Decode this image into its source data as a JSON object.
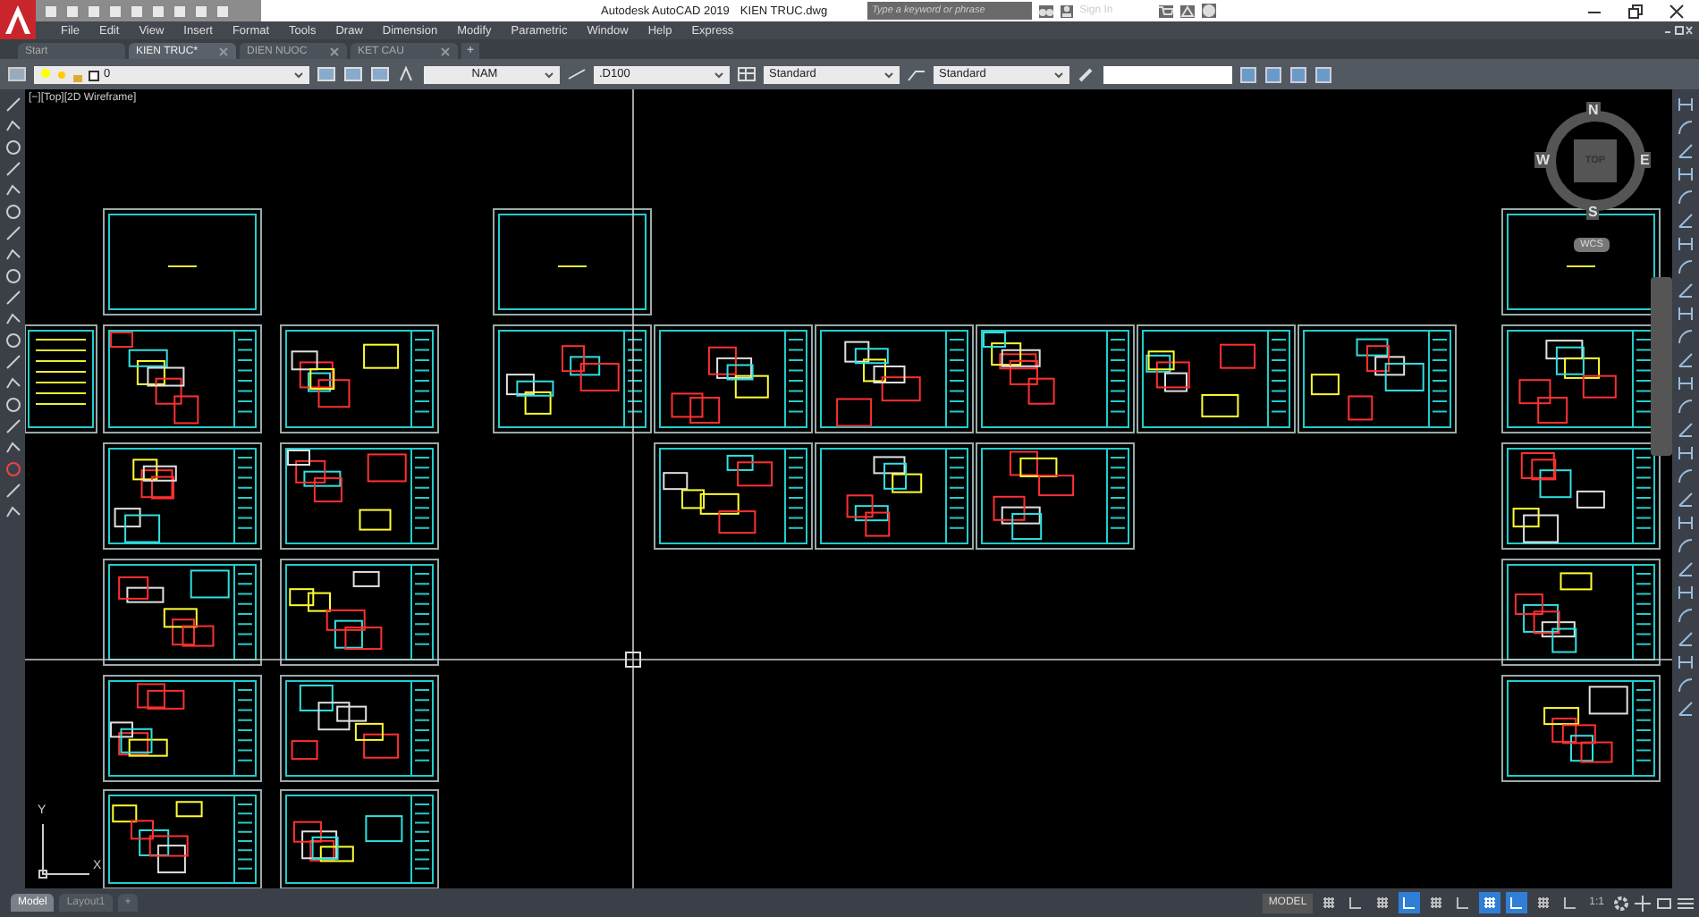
{
  "window": {
    "app_title": "Autodesk AutoCAD 2019",
    "file_name": "KIEN TRUC.dwg"
  },
  "search": {
    "placeholder": "Type a keyword or phrase"
  },
  "sign_in": "Sign In",
  "menu": [
    "File",
    "Edit",
    "View",
    "Insert",
    "Format",
    "Tools",
    "Draw",
    "Dimension",
    "Modify",
    "Parametric",
    "Window",
    "Help",
    "Express"
  ],
  "doc_tabs": [
    {
      "label": "Start",
      "selected": false,
      "closable": false
    },
    {
      "label": "KIEN TRUC*",
      "selected": true,
      "closable": true
    },
    {
      "label": "DIEN NUOC",
      "selected": false,
      "closable": true
    },
    {
      "label": "KET CAU",
      "selected": false,
      "closable": true
    }
  ],
  "new_tab": "+",
  "toolbar": {
    "layer": "0",
    "text_style": "NAM",
    "dim_style": ".D100",
    "table_style": "Standard",
    "multileader_style": "Standard"
  },
  "viewport_label": "[−][Top][2D Wireframe]",
  "viewcube": {
    "top": "TOP",
    "north": "N",
    "south": "S",
    "east": "E",
    "west": "W",
    "ucs": "WCS"
  },
  "ucs_icon": {
    "x": "X",
    "y": "Y"
  },
  "layout_tabs": [
    {
      "label": "Model",
      "selected": true
    },
    {
      "label": "Layout1",
      "selected": false
    }
  ],
  "new_layout": "+",
  "status_bar": {
    "space": "MODEL",
    "annotation_scale": "1:1",
    "toggles": [
      {
        "on": false
      },
      {
        "on": false
      },
      {
        "on": false
      },
      {
        "on": true
      },
      {
        "on": false
      },
      {
        "on": false
      },
      {
        "on": true
      },
      {
        "on": true
      },
      {
        "on": false
      },
      {
        "on": false
      }
    ]
  }
}
